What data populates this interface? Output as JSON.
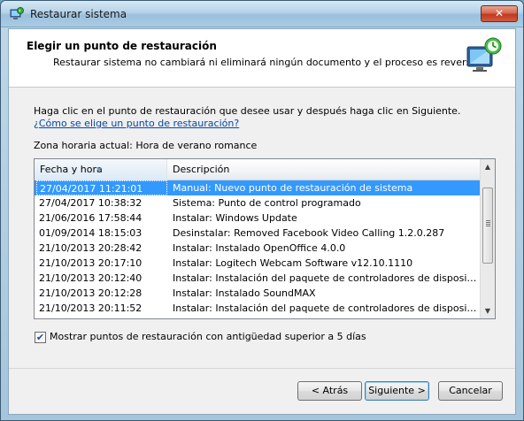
{
  "window": {
    "title": "Restaurar sistema",
    "close_glyph": "✕"
  },
  "header": {
    "title": "Elegir un punto de restauración",
    "subtitle": "Restaurar sistema no cambiará ni eliminará ningún documento y el proceso es reversible."
  },
  "instructions": {
    "text": "Haga clic en el punto de restauración que desee usar y después haga clic en Siguiente. ",
    "link": "¿Cómo se elige un punto de restauración?"
  },
  "timezone": "Zona horaria actual: Hora de verano romance",
  "table": {
    "columns": [
      "Fecha y hora",
      "Descripción"
    ],
    "rows": [
      {
        "date": "27/04/2017 11:21:01",
        "desc": "Manual: Nuevo punto de restauración de sistema",
        "selected": true
      },
      {
        "date": "27/04/2017 10:38:32",
        "desc": "Sistema: Punto de control programado"
      },
      {
        "date": "21/06/2016 17:58:44",
        "desc": "Instalar: Windows Update"
      },
      {
        "date": "01/09/2014 18:15:03",
        "desc": "Desinstalar: Removed Facebook Video Calling 1.2.0.287"
      },
      {
        "date": "21/10/2013 20:28:42",
        "desc": "Instalar: Instalado OpenOffice 4.0.0"
      },
      {
        "date": "21/10/2013 20:17:10",
        "desc": "Instalar: Logitech Webcam Software v12.10.1110"
      },
      {
        "date": "21/10/2013 20:12:40",
        "desc": "Instalar: Instalación del paquete de controladores de dispositivo: A..."
      },
      {
        "date": "21/10/2013 20:12:28",
        "desc": "Instalar: Instalado SoundMAX"
      },
      {
        "date": "21/10/2013 20:11:52",
        "desc": "Instalar: Instalación del paquete de controladores de dispositivo: In..."
      }
    ]
  },
  "checkbox": {
    "label": "Mostrar puntos de restauración con antigüedad superior a 5 días",
    "checked": true
  },
  "buttons": {
    "back": "< Atrás",
    "next": "Siguiente >",
    "cancel": "Cancelar"
  },
  "colors": {
    "selection": "#3399ff",
    "link": "#0645ad"
  }
}
